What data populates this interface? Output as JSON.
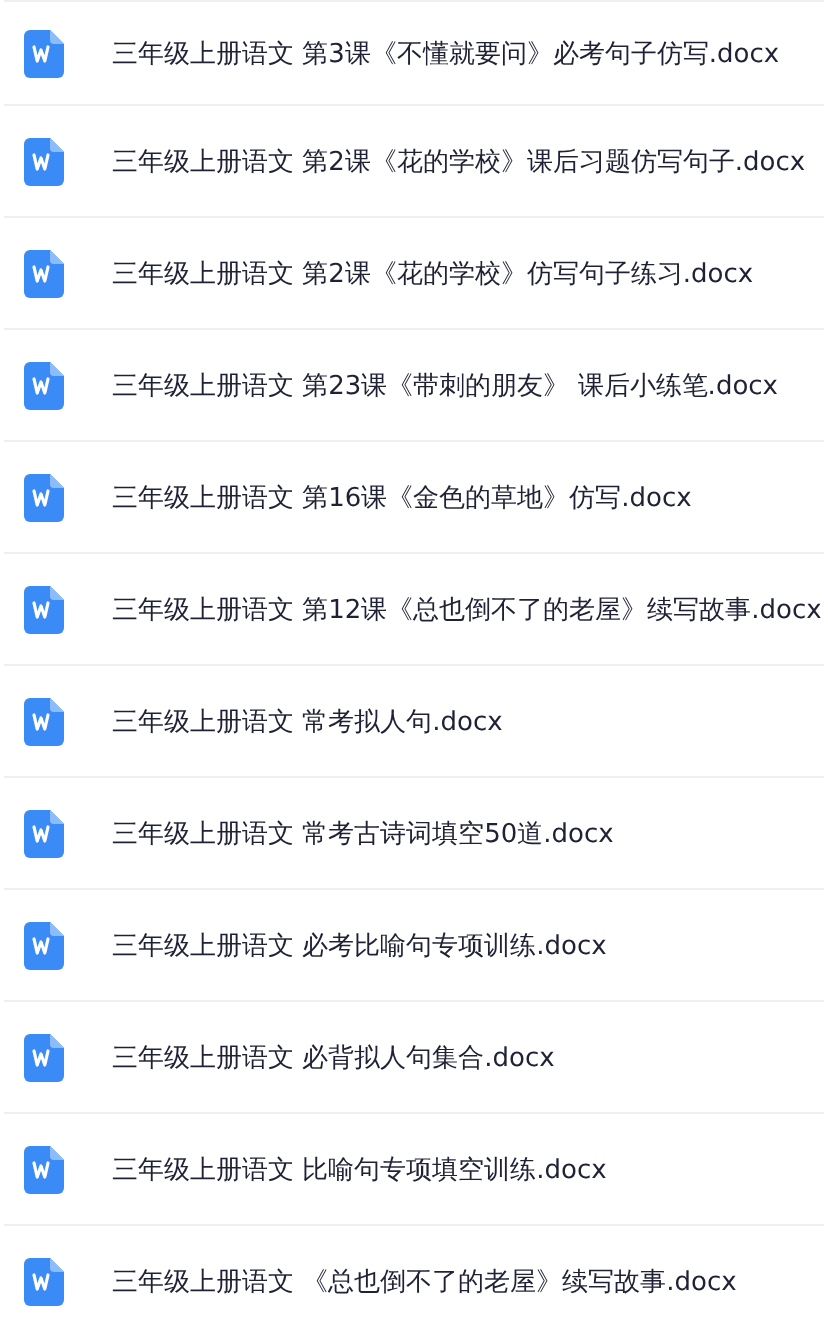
{
  "files": [
    {
      "name": "三年级上册语文 第3课《不懂就要问》必考句子仿写.docx"
    },
    {
      "name": "三年级上册语文 第2课《花的学校》课后习题仿写句子.docx"
    },
    {
      "name": "三年级上册语文 第2课《花的学校》仿写句子练习.docx"
    },
    {
      "name": "三年级上册语文 第23课《带刺的朋友》 课后小练笔.docx"
    },
    {
      "name": "三年级上册语文 第16课《金色的草地》仿写.docx"
    },
    {
      "name": "三年级上册语文 第12课《总也倒不了的老屋》续写故事.docx"
    },
    {
      "name": "三年级上册语文 常考拟人句.docx"
    },
    {
      "name": "三年级上册语文 常考古诗词填空50道.docx"
    },
    {
      "name": "三年级上册语文 必考比喻句专项训练.docx"
    },
    {
      "name": "三年级上册语文 必背拟人句集合.docx"
    },
    {
      "name": "三年级上册语文 比喻句专项填空训练.docx"
    },
    {
      "name": "三年级上册语文 《总也倒不了的老屋》续写故事.docx"
    }
  ]
}
